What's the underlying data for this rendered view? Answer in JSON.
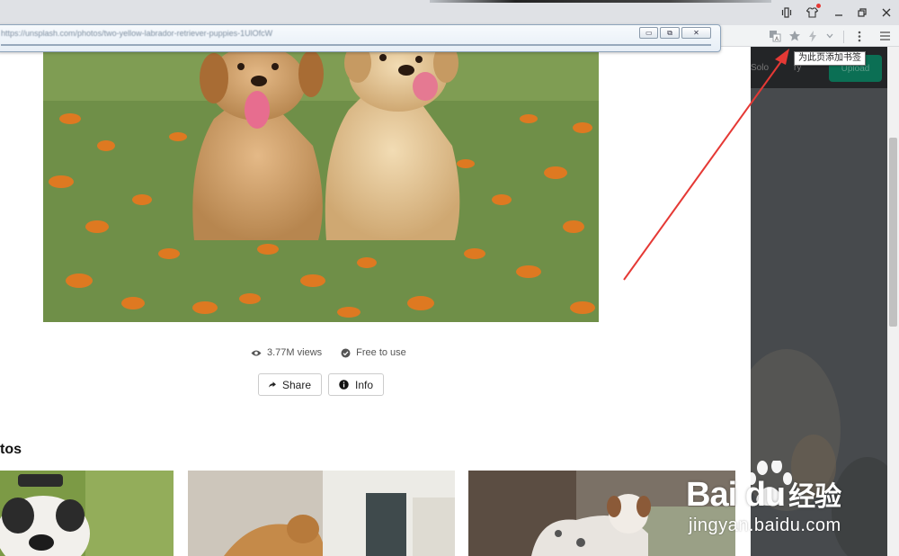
{
  "browser": {
    "url_text": "https://unsplash.com/photos/two-yellow-labrador-retriever-puppies-1UlOfcW",
    "popup_buttons": [
      "▭",
      "⧉",
      "✕"
    ],
    "bookmark_tooltip": "为此页添加书签"
  },
  "page": {
    "views": "3.77M views",
    "license": "Free to use",
    "share_label": "Share",
    "info_label": "Info",
    "section_title_partial": "tos"
  },
  "side_panel": {
    "upload_label": "Upload",
    "nav_fragment_1": "Solo",
    "nav_fragment_2": "ry"
  },
  "watermark": {
    "brand": "Bai du",
    "brand_suffix": "经验",
    "url": "jingyan.baidu.com"
  },
  "colors": {
    "annotation_arrow": "#e53935",
    "upload_button": "#0b6f54",
    "side_panel": "#474a4d"
  }
}
